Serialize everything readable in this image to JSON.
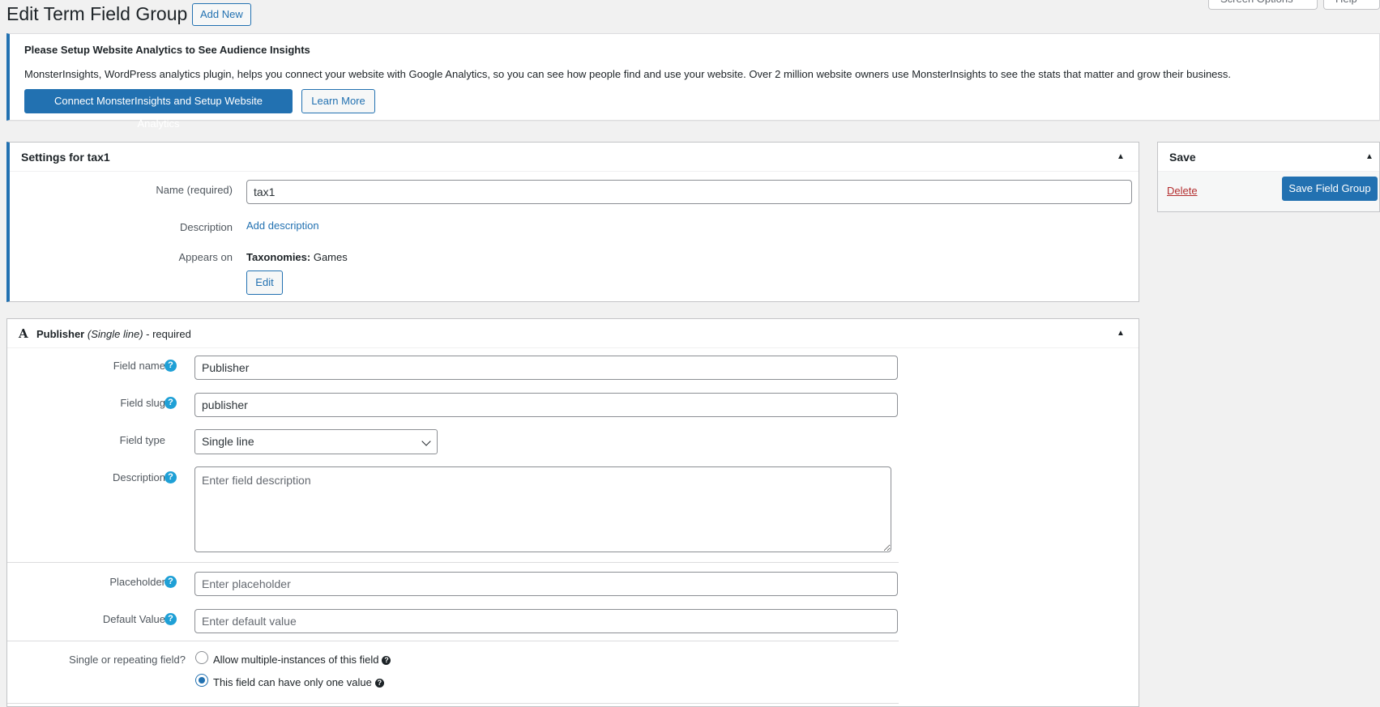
{
  "header": {
    "title": "Edit Term Field Group",
    "add_new_label": "Add New",
    "screen_options_label": "Screen Options",
    "help_label": "Help"
  },
  "notice": {
    "title": "Please Setup Website Analytics to See Audience Insights",
    "text": "MonsterInsights, WordPress analytics plugin, helps you connect your website with Google Analytics, so you can see how people find and use your website. Over 2 million website owners use MonsterInsights to see the stats that matter and grow their business.",
    "connect_label": "Connect MonsterInsights and Setup Website Analytics",
    "learn_more_label": "Learn More"
  },
  "settings": {
    "title": "Settings for tax1",
    "name_label": "Name (required)",
    "name_value": "tax1",
    "description_label": "Description",
    "add_description_link": "Add description",
    "appears_on_label": "Appears on",
    "taxonomies_label": "Taxonomies:",
    "taxonomies_value": "Games",
    "edit_label": "Edit"
  },
  "save": {
    "title": "Save",
    "delete_label": "Delete",
    "save_label": "Save Field Group"
  },
  "field": {
    "type_icon": "A",
    "name": "Publisher",
    "type_note": "(Single line)",
    "required_note": "- required",
    "field_name_label": "Field name",
    "field_name_value": "Publisher",
    "field_slug_label": "Field slug",
    "field_slug_value": "publisher",
    "field_type_label": "Field type",
    "field_type_value": "Single line",
    "description_label": "Description",
    "description_placeholder": "Enter field description",
    "placeholder_label": "Placeholder",
    "placeholder_placeholder": "Enter placeholder",
    "default_label": "Default Value",
    "default_placeholder": "Enter default value",
    "repeat_label": "Single or repeating field?",
    "repeat_option_multiple": "Allow multiple-instances of this field",
    "repeat_option_single": "This field can have only one value",
    "help_glyph": "?"
  },
  "colors": {
    "accent": "#2271b1",
    "help_icon": "#1fa0d6",
    "delete": "#b32d2e"
  }
}
